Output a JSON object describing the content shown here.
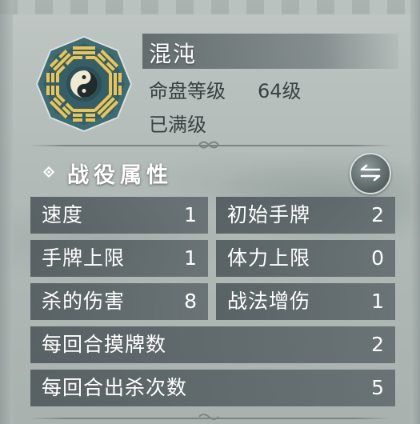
{
  "profile": {
    "name": "混沌",
    "level_label": "命盘等级",
    "level_value": "64级",
    "status": "已满级"
  },
  "section": {
    "title": "战役属性"
  },
  "stats_half": [
    {
      "label": "速度",
      "value": "1"
    },
    {
      "label": "初始手牌",
      "value": "2"
    },
    {
      "label": "手牌上限",
      "value": "1"
    },
    {
      "label": "体力上限",
      "value": "0"
    },
    {
      "label": "杀的伤害",
      "value": "8"
    },
    {
      "label": "战法增伤",
      "value": "1"
    }
  ],
  "stats_full": [
    {
      "label": "每回合摸牌数",
      "value": "2"
    },
    {
      "label": "每回合出杀次数",
      "value": "5"
    }
  ],
  "icons": {
    "emblem": "bagua-taiji-emblem",
    "section": "diamond-icon",
    "swap": "swap-arrows-icon"
  },
  "colors": {
    "emblem_gold": "#e8c45a",
    "cell_bg": "#4b565a",
    "text_light": "#ffffff",
    "text_dark": "#3a4042"
  }
}
